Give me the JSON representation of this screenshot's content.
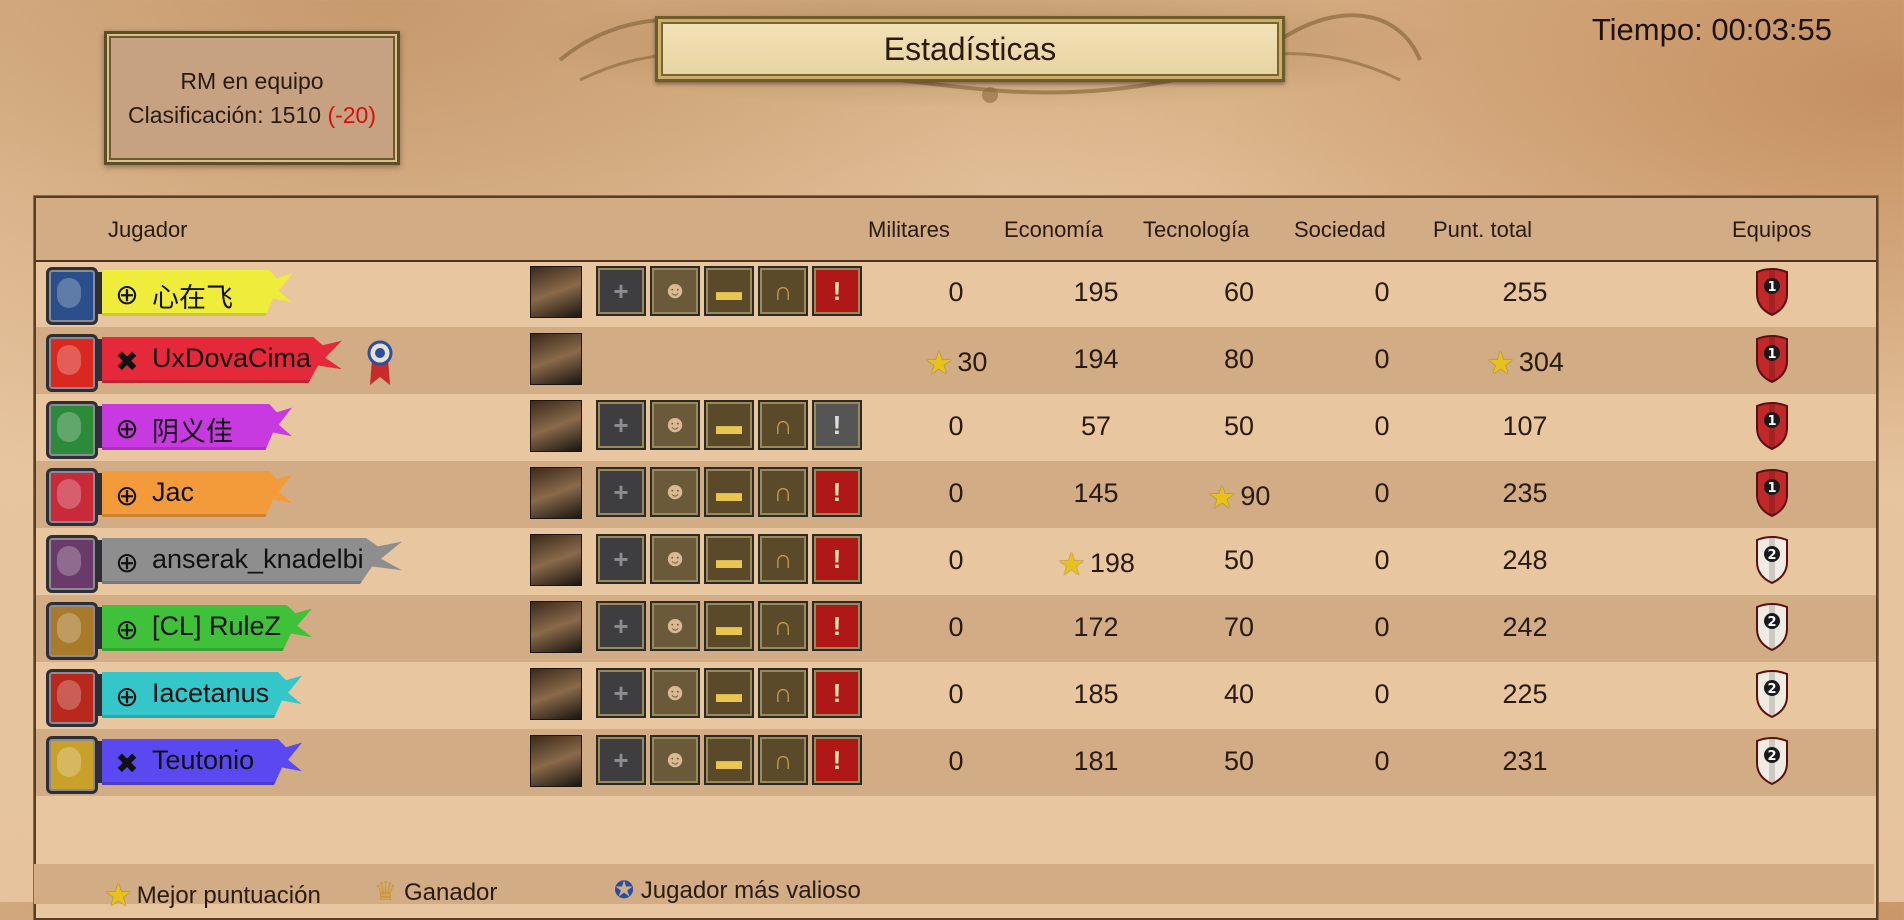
{
  "header": {
    "title": "Estadísticas",
    "timer": "Tiempo: 00:03:55"
  },
  "rank": {
    "mode": "RM en equipo",
    "rating_label": "Clasificación: 1510",
    "rating_delta": "(-20)"
  },
  "columns": {
    "player": "Jugador",
    "military": "Militares",
    "economy": "Economía",
    "technology": "Tecnología",
    "society": "Sociedad",
    "total": "Punt. total",
    "teams": "Equipos"
  },
  "players": [
    {
      "name": "心在飞",
      "platform": "globe-icon",
      "banner_color": "#f0ec3c",
      "civ_color": "#2a4f8a",
      "military": "0",
      "economy": "195",
      "technology": "60",
      "society": "0",
      "total": "255",
      "team": "1",
      "team_color": "#c0282a",
      "report_active": true,
      "has_actions": true
    },
    {
      "name": "UxDovaCima",
      "platform": "xbox-icon",
      "banner_color": "#e5283a",
      "civ_color": "#d8281f",
      "military": "30",
      "economy": "194",
      "technology": "80",
      "society": "0",
      "total": "304",
      "team": "1",
      "team_color": "#c0282a",
      "mvp": true,
      "best_military": true,
      "best_total": true,
      "has_actions": false
    },
    {
      "name": "阴义佳",
      "platform": "globe-icon",
      "banner_color": "#c63ae0",
      "civ_color": "#2c8a3a",
      "military": "0",
      "economy": "57",
      "technology": "50",
      "society": "0",
      "total": "107",
      "team": "1",
      "team_color": "#c0282a",
      "report_active": false,
      "has_actions": true
    },
    {
      "name": "Jac",
      "platform": "globe-icon",
      "banner_color": "#f39a3a",
      "civ_color": "#c82a3a",
      "military": "0",
      "economy": "145",
      "technology": "90",
      "society": "0",
      "total": "235",
      "team": "1",
      "team_color": "#c0282a",
      "best_technology": true,
      "report_active": true,
      "has_actions": true
    },
    {
      "name": "anserak_knadelbi",
      "platform": "globe-icon",
      "banner_color": "#8e8e8e",
      "civ_color": "#6a3a6a",
      "military": "0",
      "economy": "198",
      "technology": "50",
      "society": "0",
      "total": "248",
      "team": "2",
      "team_color": "#f0ece4",
      "best_economy": true,
      "report_active": true,
      "has_actions": true
    },
    {
      "name": "[CL] RuleZ",
      "platform": "globe-icon",
      "banner_color": "#3fc23a",
      "civ_color": "#a87a2a",
      "military": "0",
      "economy": "172",
      "technology": "70",
      "society": "0",
      "total": "242",
      "team": "2",
      "team_color": "#f0ece4",
      "report_active": true,
      "has_actions": true
    },
    {
      "name": "Iacetanus",
      "platform": "globe-icon",
      "banner_color": "#34c6c8",
      "civ_color": "#b8281c",
      "military": "0",
      "economy": "185",
      "technology": "40",
      "society": "0",
      "total": "225",
      "team": "2",
      "team_color": "#f0ece4",
      "report_active": true,
      "has_actions": true
    },
    {
      "name": "Teutonio",
      "platform": "xbox-icon",
      "banner_color": "#5a48f0",
      "civ_color": "#c8a02a",
      "military": "0",
      "economy": "181",
      "technology": "50",
      "society": "0",
      "total": "231",
      "team": "2",
      "team_color": "#f0ece4",
      "report_active": true,
      "has_actions": true
    }
  ],
  "legend": {
    "best": "Mejor puntuación",
    "winner": "Ganador",
    "mvp": "Jugador más valioso"
  },
  "colors": {
    "accent_red": "#d41010",
    "star": "#e6c21a"
  }
}
